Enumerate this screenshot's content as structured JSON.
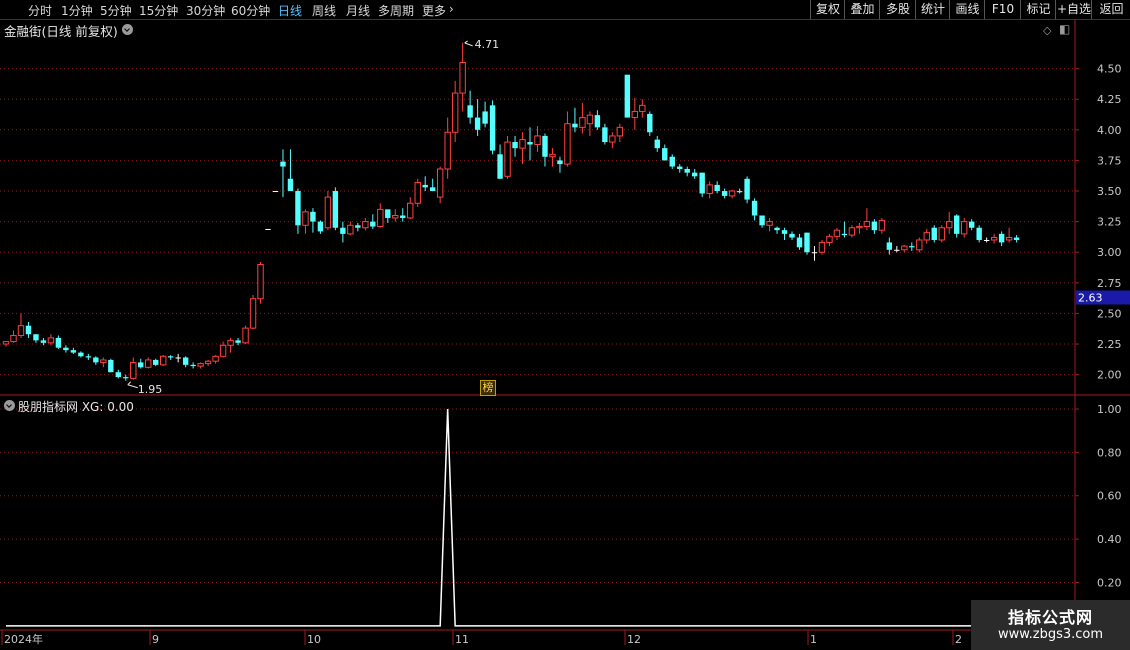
{
  "toolbar": {
    "periods": [
      "分时",
      "1分钟",
      "5分钟",
      "15分钟",
      "30分钟",
      "60分钟",
      "日线",
      "周线",
      "月线",
      "多周期",
      "更多"
    ],
    "active_period": "日线",
    "buttons": [
      "复权",
      "叠加",
      "多股",
      "统计",
      "画线",
      "F10",
      "标记",
      "+自选",
      "返回"
    ]
  },
  "main_panel": {
    "title": "金融街(日线 前复权)",
    "current_price_label": "2.63",
    "high_label": "4.71",
    "low_label": "1.95",
    "badge": "榜"
  },
  "indicator_panel": {
    "title": "股朋指标网 XG: 0.00"
  },
  "x_axis": {
    "labels": [
      "2024年",
      "9",
      "10",
      "11",
      "12",
      "1",
      "2"
    ]
  },
  "watermark": {
    "title": "指标公式网",
    "url": "www.zbgs3.com"
  },
  "colors": {
    "up": "#ff4040",
    "down": "#54ffff",
    "grid": "#8b1a1a",
    "line": "#ffffff"
  },
  "chart_data": [
    {
      "type": "candlestick",
      "title": "金融街(日线 前复权)",
      "y_ticks": [
        2.0,
        2.25,
        2.5,
        2.75,
        3.0,
        3.25,
        3.5,
        3.75,
        4.0,
        4.25,
        4.5
      ],
      "y_tick_labels": [
        "2.00",
        "2.25",
        "2.50",
        "2.75",
        "3.00",
        "3.25",
        "3.50",
        "3.75",
        "4.00",
        "4.25",
        "4.50"
      ],
      "ylim": [
        1.85,
        4.75
      ],
      "x_range": [
        0,
        142
      ],
      "highlight_value": 2.63,
      "annotations": [
        {
          "label": "4.71",
          "value": 4.71,
          "index": 61
        },
        {
          "label": "1.95",
          "value": 1.95,
          "index": 16
        }
      ],
      "candles": [
        [
          2.25,
          2.27,
          2.23,
          2.27
        ],
        [
          2.27,
          2.36,
          2.26,
          2.32
        ],
        [
          2.32,
          2.5,
          2.3,
          2.4
        ],
        [
          2.4,
          2.43,
          2.3,
          2.33
        ],
        [
          2.33,
          2.33,
          2.26,
          2.28
        ],
        [
          2.28,
          2.3,
          2.24,
          2.26
        ],
        [
          2.26,
          2.33,
          2.24,
          2.3
        ],
        [
          2.3,
          2.32,
          2.21,
          2.22
        ],
        [
          2.22,
          2.24,
          2.18,
          2.2
        ],
        [
          2.2,
          2.22,
          2.17,
          2.18
        ],
        [
          2.18,
          2.19,
          2.14,
          2.15
        ],
        [
          2.15,
          2.17,
          2.12,
          2.14
        ],
        [
          2.14,
          2.15,
          2.08,
          2.1
        ],
        [
          2.1,
          2.14,
          2.06,
          2.12
        ],
        [
          2.12,
          2.13,
          2.02,
          2.02
        ],
        [
          2.02,
          2.04,
          1.97,
          1.98
        ],
        [
          1.98,
          2.0,
          1.95,
          1.97
        ],
        [
          1.97,
          2.14,
          1.96,
          2.1
        ],
        [
          2.1,
          2.13,
          2.05,
          2.06
        ],
        [
          2.06,
          2.14,
          2.05,
          2.12
        ],
        [
          2.12,
          2.13,
          2.07,
          2.08
        ],
        [
          2.08,
          2.16,
          2.07,
          2.15
        ],
        [
          2.15,
          2.16,
          2.12,
          2.14
        ],
        [
          2.14,
          2.17,
          2.1,
          2.14
        ],
        [
          2.14,
          2.15,
          2.06,
          2.08
        ],
        [
          2.08,
          2.1,
          2.05,
          2.07
        ],
        [
          2.07,
          2.1,
          2.05,
          2.09
        ],
        [
          2.09,
          2.12,
          2.07,
          2.11
        ],
        [
          2.11,
          2.16,
          2.09,
          2.15
        ],
        [
          2.15,
          2.27,
          2.14,
          2.24
        ],
        [
          2.24,
          2.3,
          2.18,
          2.28
        ],
        [
          2.28,
          2.3,
          2.24,
          2.26
        ],
        [
          2.26,
          2.4,
          2.25,
          2.38
        ],
        [
          2.38,
          2.65,
          2.37,
          2.62
        ],
        [
          2.62,
          2.92,
          2.58,
          2.9
        ],
        [
          3.19,
          3.19,
          3.19,
          3.19
        ],
        [
          3.5,
          3.5,
          3.5,
          3.5
        ],
        [
          3.74,
          3.84,
          3.45,
          3.7
        ],
        [
          3.6,
          3.84,
          3.5,
          3.5
        ],
        [
          3.5,
          3.52,
          3.15,
          3.22
        ],
        [
          3.22,
          3.35,
          3.15,
          3.33
        ],
        [
          3.33,
          3.36,
          3.16,
          3.25
        ],
        [
          3.25,
          3.26,
          3.15,
          3.17
        ],
        [
          3.2,
          3.5,
          3.18,
          3.45
        ],
        [
          3.5,
          3.53,
          3.18,
          3.2
        ],
        [
          3.2,
          3.25,
          3.08,
          3.15
        ],
        [
          3.15,
          3.25,
          3.14,
          3.22
        ],
        [
          3.22,
          3.24,
          3.17,
          3.2
        ],
        [
          3.2,
          3.28,
          3.18,
          3.25
        ],
        [
          3.25,
          3.31,
          3.19,
          3.21
        ],
        [
          3.21,
          3.4,
          3.2,
          3.35
        ],
        [
          3.35,
          3.35,
          3.24,
          3.28
        ],
        [
          3.28,
          3.35,
          3.25,
          3.3
        ],
        [
          3.3,
          3.36,
          3.25,
          3.28
        ],
        [
          3.28,
          3.45,
          3.27,
          3.4
        ],
        [
          3.4,
          3.6,
          3.37,
          3.57
        ],
        [
          3.55,
          3.62,
          3.5,
          3.53
        ],
        [
          3.53,
          3.6,
          3.5,
          3.5
        ],
        [
          3.45,
          3.7,
          3.4,
          3.68
        ],
        [
          3.68,
          4.1,
          3.6,
          3.98
        ],
        [
          3.98,
          4.4,
          3.9,
          4.3
        ],
        [
          4.3,
          4.71,
          4.15,
          4.55
        ],
        [
          4.2,
          4.32,
          4.05,
          4.1
        ],
        [
          4.1,
          4.25,
          3.95,
          4.0
        ],
        [
          4.15,
          4.23,
          4.02,
          4.05
        ],
        [
          4.2,
          4.24,
          3.8,
          3.83
        ],
        [
          3.8,
          3.88,
          3.6,
          3.6
        ],
        [
          3.62,
          3.95,
          3.6,
          3.9
        ],
        [
          3.9,
          3.95,
          3.78,
          3.85
        ],
        [
          3.85,
          3.98,
          3.72,
          3.92
        ],
        [
          3.9,
          4.02,
          3.75,
          3.88
        ],
        [
          3.88,
          4.03,
          3.82,
          3.95
        ],
        [
          3.95,
          3.97,
          3.7,
          3.78
        ],
        [
          3.78,
          3.85,
          3.7,
          3.8
        ],
        [
          3.75,
          3.78,
          3.65,
          3.72
        ],
        [
          3.72,
          4.15,
          3.7,
          4.05
        ],
        [
          4.05,
          4.18,
          3.98,
          4.02
        ],
        [
          4.02,
          4.22,
          3.97,
          4.1
        ],
        [
          4.05,
          4.15,
          3.95,
          4.12
        ],
        [
          4.12,
          4.16,
          4.0,
          4.02
        ],
        [
          4.02,
          4.05,
          3.88,
          3.9
        ],
        [
          3.9,
          3.98,
          3.85,
          3.95
        ],
        [
          3.95,
          4.05,
          3.9,
          4.02
        ],
        [
          4.45,
          4.45,
          4.1,
          4.1
        ],
        [
          4.1,
          4.26,
          4.0,
          4.15
        ],
        [
          4.15,
          4.25,
          4.1,
          4.2
        ],
        [
          4.13,
          4.15,
          3.95,
          3.98
        ],
        [
          3.92,
          3.95,
          3.82,
          3.85
        ],
        [
          3.85,
          3.88,
          3.75,
          3.75
        ],
        [
          3.78,
          3.8,
          3.68,
          3.7
        ],
        [
          3.7,
          3.72,
          3.65,
          3.68
        ],
        [
          3.68,
          3.7,
          3.62,
          3.65
        ],
        [
          3.65,
          3.68,
          3.6,
          3.62
        ],
        [
          3.65,
          3.65,
          3.45,
          3.48
        ],
        [
          3.48,
          3.58,
          3.44,
          3.55
        ],
        [
          3.55,
          3.58,
          3.48,
          3.5
        ],
        [
          3.5,
          3.52,
          3.44,
          3.46
        ],
        [
          3.46,
          3.51,
          3.44,
          3.5
        ],
        [
          3.5,
          3.52,
          3.48,
          3.49
        ],
        [
          3.6,
          3.62,
          3.4,
          3.43
        ],
        [
          3.42,
          3.44,
          3.26,
          3.3
        ],
        [
          3.3,
          3.3,
          3.2,
          3.22
        ],
        [
          3.22,
          3.28,
          3.17,
          3.25
        ],
        [
          3.2,
          3.21,
          3.15,
          3.18
        ],
        [
          3.18,
          3.2,
          3.1,
          3.15
        ],
        [
          3.15,
          3.17,
          3.1,
          3.12
        ],
        [
          3.12,
          3.15,
          3.02,
          3.04
        ],
        [
          3.16,
          3.16,
          2.98,
          3.0
        ],
        [
          3.0,
          3.05,
          2.93,
          3.0
        ],
        [
          3.0,
          3.1,
          2.98,
          3.08
        ],
        [
          3.08,
          3.15,
          3.05,
          3.13
        ],
        [
          3.13,
          3.2,
          3.1,
          3.18
        ],
        [
          3.15,
          3.25,
          3.12,
          3.14
        ],
        [
          3.14,
          3.22,
          3.12,
          3.2
        ],
        [
          3.2,
          3.24,
          3.15,
          3.21
        ],
        [
          3.21,
          3.36,
          3.18,
          3.25
        ],
        [
          3.25,
          3.27,
          3.15,
          3.18
        ],
        [
          3.18,
          3.28,
          3.15,
          3.26
        ],
        [
          3.08,
          3.12,
          2.98,
          3.02
        ],
        [
          3.02,
          3.05,
          3.0,
          3.02
        ],
        [
          3.02,
          3.06,
          3.0,
          3.05
        ],
        [
          3.05,
          3.08,
          3.01,
          3.04
        ],
        [
          3.02,
          3.12,
          3.0,
          3.1
        ],
        [
          3.1,
          3.19,
          3.07,
          3.16
        ],
        [
          3.2,
          3.22,
          3.08,
          3.1
        ],
        [
          3.1,
          3.22,
          3.08,
          3.2
        ],
        [
          3.2,
          3.33,
          3.15,
          3.25
        ],
        [
          3.3,
          3.31,
          3.12,
          3.15
        ],
        [
          3.15,
          3.28,
          3.12,
          3.25
        ],
        [
          3.25,
          3.27,
          3.18,
          3.2
        ],
        [
          3.2,
          3.22,
          3.08,
          3.1
        ],
        [
          3.1,
          3.12,
          3.08,
          3.1
        ],
        [
          3.1,
          3.15,
          3.07,
          3.12
        ],
        [
          3.15,
          3.17,
          3.05,
          3.08
        ],
        [
          3.1,
          3.2,
          3.08,
          3.12
        ],
        [
          3.12,
          3.14,
          3.08,
          3.1
        ]
      ]
    },
    {
      "type": "line",
      "title": "股朋指标网 XG: 0.00",
      "y_ticks": [
        0.2,
        0.4,
        0.6,
        0.8,
        1.0
      ],
      "y_tick_labels": [
        "0.20",
        "0.40",
        "0.60",
        "0.80",
        "1.00"
      ],
      "ylim": [
        -0.01,
        1.06
      ],
      "x_range": [
        0,
        142
      ],
      "series": [
        {
          "values": [
            [
              0,
              0
            ],
            [
              58,
              0
            ],
            [
              59,
              1
            ],
            [
              60,
              0
            ],
            [
              142,
              0
            ]
          ]
        }
      ]
    }
  ]
}
